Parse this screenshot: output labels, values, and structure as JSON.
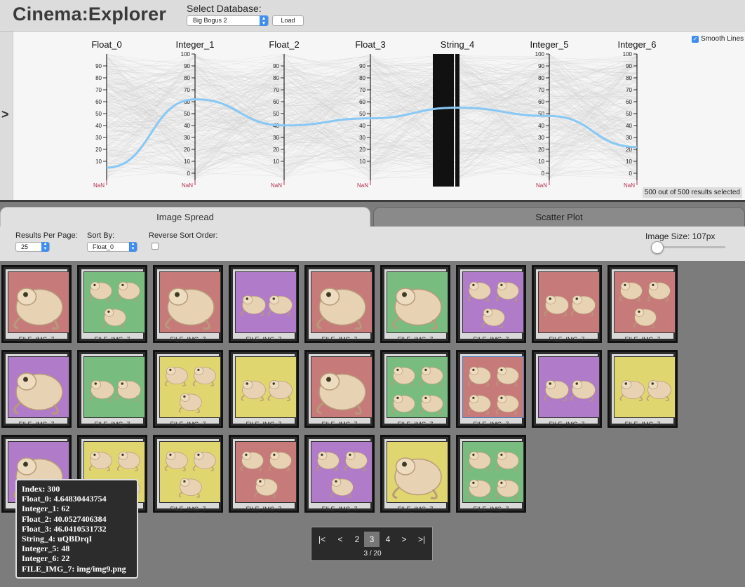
{
  "header": {
    "title": "Cinema:Explorer",
    "db_label": "Select Database:",
    "db_selected": "Big Bogus 2",
    "load_label": "Load"
  },
  "pc": {
    "toggle": ">",
    "smooth_label": "Smooth Lines",
    "selection_text": "500 out of 500 results selected",
    "axes": [
      "Float_0",
      "Integer_1",
      "Float_2",
      "Float_3",
      "String_4",
      "Integer_5",
      "Integer_6"
    ],
    "nan_label": "NaN",
    "highlight_color": "#87c8f5",
    "nan_color": "#b03050"
  },
  "tabs": [
    "Image Spread",
    "Scatter Plot"
  ],
  "controls": {
    "results_label": "Results Per Page:",
    "results_value": "25",
    "sort_label": "Sort By:",
    "sort_value": "Float_0",
    "reverse_label": "Reverse Sort Order:",
    "size_label": "Image Size: 107px"
  },
  "grid": {
    "card_label": "FILE_IMG_7",
    "cards": [
      {
        "color": "#c77a7a",
        "frogs": 1
      },
      {
        "color": "#78bd7f",
        "frogs": 3
      },
      {
        "color": "#c77a7a",
        "frogs": 1
      },
      {
        "color": "#b07bc8",
        "frogs": 2
      },
      {
        "color": "#c77a7a",
        "frogs": 1
      },
      {
        "color": "#78bd7f",
        "frogs": 1
      },
      {
        "color": "#b07bc8",
        "frogs": 3
      },
      {
        "color": "#c77a7a",
        "frogs": 2
      },
      {
        "color": "#c77a7a",
        "frogs": 3
      },
      {
        "color": "#b07bc8",
        "frogs": 1
      },
      {
        "color": "#78bd7f",
        "frogs": 2
      },
      {
        "color": "#e0d670",
        "frogs": 3
      },
      {
        "color": "#e0d670",
        "frogs": 2
      },
      {
        "color": "#c77a7a",
        "frogs": 1
      },
      {
        "color": "#78bd7f",
        "frogs": 4
      },
      {
        "color": "#c77a7a",
        "frogs": 4
      },
      {
        "color": "#b07bc8",
        "frogs": 2
      },
      {
        "color": "#e0d670",
        "frogs": 2
      },
      {
        "color": "#b07bc8",
        "frogs": 1
      },
      {
        "color": "#e0d670",
        "frogs": 4
      },
      {
        "color": "#e0d670",
        "frogs": 3
      },
      {
        "color": "#c77a7a",
        "frogs": 3
      },
      {
        "color": "#b07bc8",
        "frogs": 3
      },
      {
        "color": "#e0d670",
        "frogs": 1
      },
      {
        "color": "#78bd7f",
        "frogs": 4
      }
    ]
  },
  "pagination": {
    "first": "|<",
    "prev": "<",
    "pages": [
      "2",
      "3",
      "4"
    ],
    "current": "3",
    "next": ">",
    "last": ">|",
    "status": "3 / 20"
  },
  "tooltip": {
    "lines": [
      "Index: 300",
      "Float_0: 4.64830443754",
      "Integer_1: 62",
      "Float_2: 40.0527406384",
      "Float_3: 46.0410531732",
      "String_4: uQBDrqI",
      "Integer_5: 48",
      "Integer_6: 22",
      "FILE_IMG_7: img/img9.png"
    ]
  }
}
